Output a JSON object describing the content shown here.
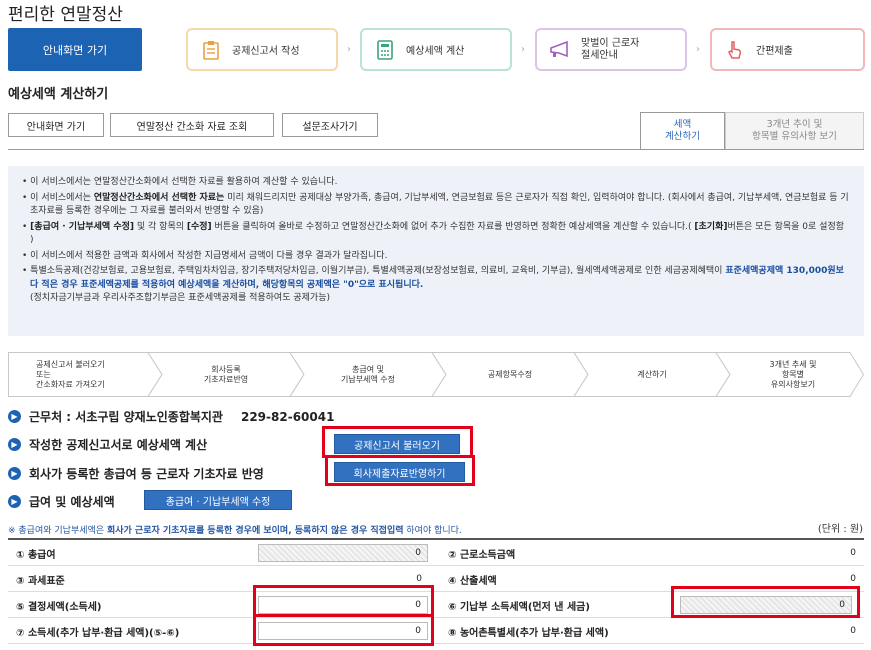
{
  "app_title": "편리한 연말정산",
  "top_nav": {
    "home": "안내화면 가기",
    "steps": [
      "공제신고서 작성",
      "예상세액 계산",
      "맞벌이 근로자\n절세안내",
      "간편제출"
    ],
    "colors": {
      "home_bg": "#1d63b3",
      "step1": "#f6d9a8",
      "step2": "#b9e3d2",
      "step3": "#dcc4e8",
      "step4": "#f1b8b8"
    }
  },
  "section_title": "예상세액 계산하기",
  "buttons": {
    "guide": "안내화면 가기",
    "simple_lookup": "연말정산 간소화 자료 조회",
    "survey": "설문조사가기"
  },
  "tabs": [
    {
      "label": "세액\n계산하기",
      "active": true
    },
    {
      "label": "3개년 추이 및\n항목별 유의사항 보기",
      "active": false
    }
  ],
  "notice": {
    "l1": "이 서비스에서는 연말정산간소화에서 선택한 자료를 활용하여 계산할 수 있습니다.",
    "l2a": "이 서비스에서는 ",
    "l2b": "연말정산간소화에서 선택한 자료는",
    "l2c": " 미리 채워드리지만 공제대상 부양가족, 총급여, 기납부세액, 연금보험료 등은 근로자가 직접 확인, 입력하여야 합니다. (회사에서 총급여, 기납부세액, 연금보험료 등 기초자료를 등록한 경우에는 그 자료를 불러와서 반영할 수 있음)",
    "l3a": "[총급여 · 기납부세액 수정]",
    "l3b": " 및 각 항목의 ",
    "l3c": "[수정]",
    "l3d": " 버튼을 클릭하여 올바로 수정하고 연말정산간소화에 없어 추가 수집한 자료를 반영하면 정확한 예상세액을 계산할 수 있습니다.( ",
    "l3e": "[초기화]",
    "l3f": "버튼은 모든 항목을 0로 설정함 )",
    "l4": "이 서비스에서 적용한 금액과 회사에서 작성한 지급명세서 금액이 다를 경우 결과가 달라집니다.",
    "l5a": "특별소득공제(건강보험료, 고용보험료, 주택임차차입금, 장기주택저당차입금, 이월기부금), 특별세액공제(보장성보험료, 의료비, 교육비, 기부금), 월세액세액공제로 인한 세금공제혜택이 ",
    "l5b": "표준세액공제액 130,000원보다 적은 경우 표준세액공제를 적용하여 예상세액을 계산하며, 해당항목의 공제액은 \"0\"으로 표시됩니다.",
    "l5c": "(정치자금기부금과 우리사주조합기부금은 표준세액공제를 적용하여도 공제가능)"
  },
  "process_steps": [
    "공제신고서 불러오기\n또는\n간소화자료 가져오기",
    "회사등록\n기초자료반영",
    "총급여 및\n기납부세액 수정",
    "공제항목수정",
    "계산하기",
    "3개년 추세 및\n항목별\n유의사항보기"
  ],
  "workplace": {
    "label": "근무처 : 서초구립 양재노인종합복지관",
    "bizno": "229-82-60041"
  },
  "rows": {
    "r1": "작성한 공제신고서로 예상세액 계산",
    "r1_button": "공제신고서 불러오기",
    "r2": "회사가 등록한 총급여 등 근로자 기초자료 반영",
    "r2_button": "회사제출자료반영하기",
    "r3": "급여 및 예상세액",
    "r3_button": "총급여 · 기납부세액 수정"
  },
  "note": {
    "a": "※ 총급여와 기납부세액은 ",
    "b": "회사가 근로자 기초자료를 등록한 경우에 보이며, 등록하지 않은 경우 직접입력",
    "c": " 하여야 합니다."
  },
  "unit": "(단위 : 원)",
  "table": [
    [
      {
        "label": "① 총급여",
        "value": "0"
      },
      {
        "label": "② 근로소득금액",
        "value": "0"
      }
    ],
    [
      {
        "label": "③ 과세표준",
        "value": "0"
      },
      {
        "label": "④ 산출세액",
        "value": "0"
      }
    ],
    [
      {
        "label": "⑤ 결정세액(소득세)",
        "value": "0"
      },
      {
        "label": "⑥ 기납부 소득세액(먼저 낸 세금)",
        "value": "0"
      }
    ],
    [
      {
        "label": "⑦ 소득세(추가 납부·환급 세액)(⑤-⑥)",
        "value": "0"
      },
      {
        "label": "⑧ 농어촌특별세(추가 납부·환급 세액)",
        "value": "0"
      }
    ]
  ],
  "highlight_color": "#e2001a"
}
